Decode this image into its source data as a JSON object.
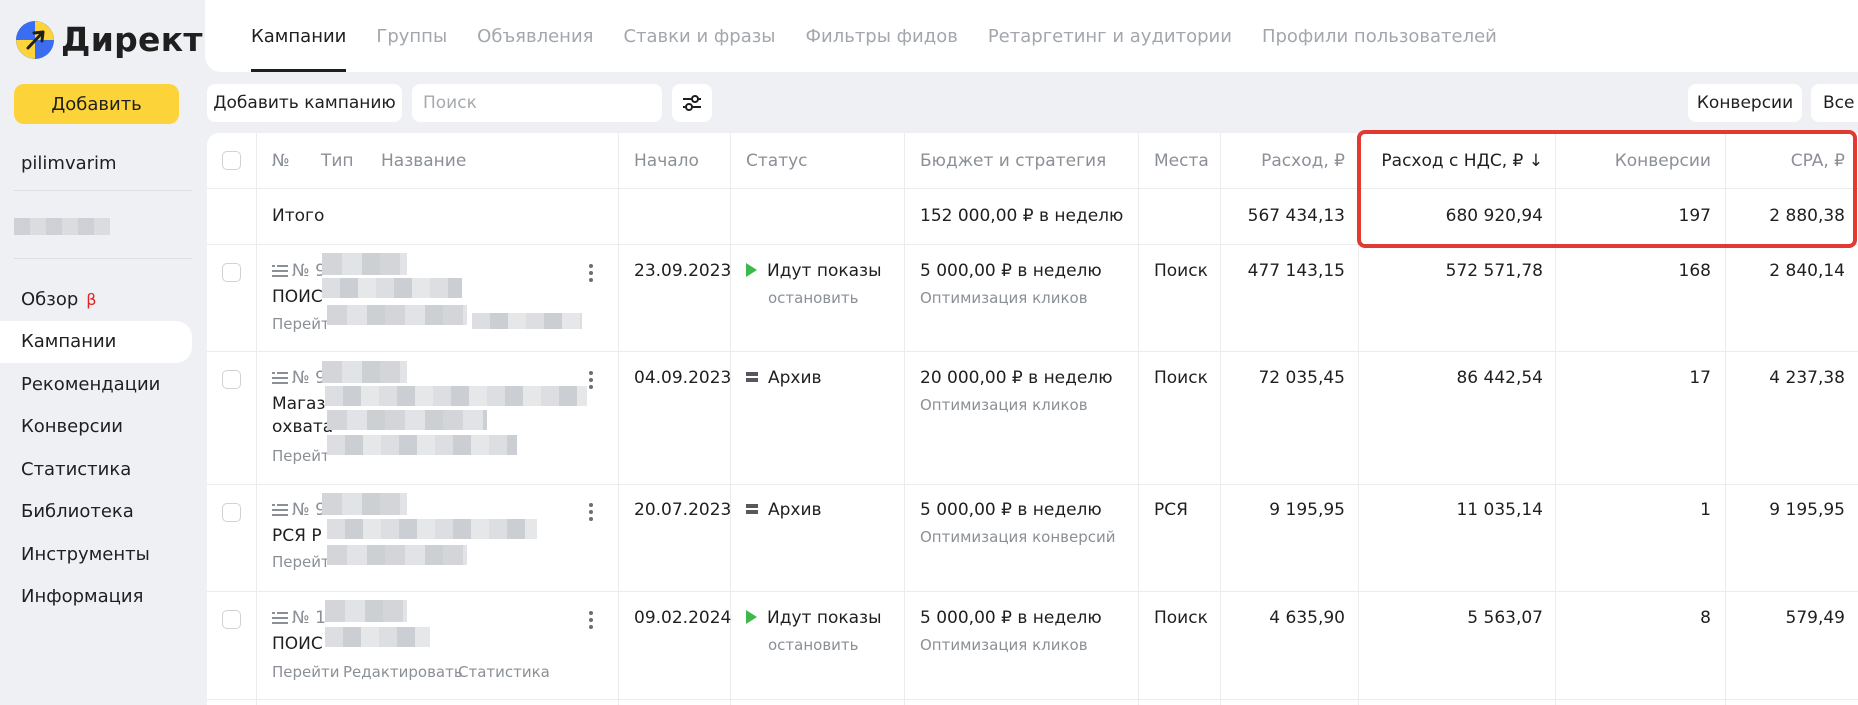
{
  "app": {
    "logo_text": "Директ"
  },
  "sidebar": {
    "add_label": "Добавить",
    "user": "pilimvarim",
    "items": [
      {
        "label": "Обзор",
        "badge": "β"
      },
      {
        "label": "Кампании"
      },
      {
        "label": "Рекомендации"
      },
      {
        "label": "Конверсии"
      },
      {
        "label": "Статистика"
      },
      {
        "label": "Библиотека"
      },
      {
        "label": "Инструменты"
      },
      {
        "label": "Информация"
      }
    ]
  },
  "tabs": [
    "Кампании",
    "Группы",
    "Объявления",
    "Ставки и фразы",
    "Фильтры фидов",
    "Ретаргетинг и аудитории",
    "Профили пользователей"
  ],
  "toolbar": {
    "add_campaign": "Добавить кампанию",
    "search_placeholder": "Поиск",
    "conversions": "Конверсии",
    "all": "Все"
  },
  "table": {
    "headers": {
      "num": "№",
      "type": "Тип",
      "name": "Название",
      "start": "Начало",
      "status": "Статус",
      "budget": "Бюджет и стратегия",
      "places": "Места",
      "spend": "Расход, ₽",
      "spend_vat": "Расход с НДС, ₽ ↓",
      "conversions": "Конверсии",
      "cpa": "CPA, ₽"
    },
    "total": {
      "label": "Итого",
      "budget": "152 000,00 ₽ в неделю",
      "spend": "567 434,13",
      "spend_vat": "680 920,94",
      "conversions": "197",
      "cpa": "2 880,38"
    },
    "rows": [
      {
        "num": "№ 9",
        "name1": "ПОИС",
        "name2": "",
        "links": "Перейт",
        "start": "23.09.2023",
        "status": "Идут показы",
        "status_kind": "active",
        "status_action": "остановить",
        "budget": "5 000,00 ₽ в неделю",
        "strategy": "Оптимизация кликов",
        "places": "Поиск",
        "spend": "477 143,15",
        "spend_vat": "572 571,78",
        "conversions": "168",
        "cpa": "2 840,14"
      },
      {
        "num": "№ 9",
        "name1": "Магаз",
        "name2": "охвата",
        "links": "Перейт",
        "start": "04.09.2023",
        "status": "Архив",
        "status_kind": "archive",
        "status_action": "",
        "budget": "20 000,00 ₽ в неделю",
        "strategy": "Оптимизация кликов",
        "places": "Поиск",
        "spend": "72 035,45",
        "spend_vat": "86 442,54",
        "conversions": "17",
        "cpa": "4 237,38"
      },
      {
        "num": "№ 9",
        "name1": "РСЯ Р",
        "name2": "",
        "links": "Перейт",
        "start": "20.07.2023",
        "status": "Архив",
        "status_kind": "archive",
        "status_action": "",
        "budget": "5 000,00 ₽ в неделю",
        "strategy": "Оптимизация конверсий",
        "places": "РСЯ",
        "spend": "9 195,95",
        "spend_vat": "11 035,14",
        "conversions": "1",
        "cpa": "9 195,95"
      },
      {
        "num": "№ 1",
        "name1": "ПОИС",
        "name2": "",
        "links": "Перейти",
        "link_edit": "Редактировать",
        "link_stats": "Статистика",
        "start": "09.02.2024",
        "status": "Идут показы",
        "status_kind": "active",
        "status_action": "остановить",
        "budget": "5 000,00 ₽ в неделю",
        "strategy": "Оптимизация кликов",
        "places": "Поиск",
        "spend": "4 635,90",
        "spend_vat": "5 563,07",
        "conversions": "8",
        "cpa": "579,49"
      }
    ]
  }
}
